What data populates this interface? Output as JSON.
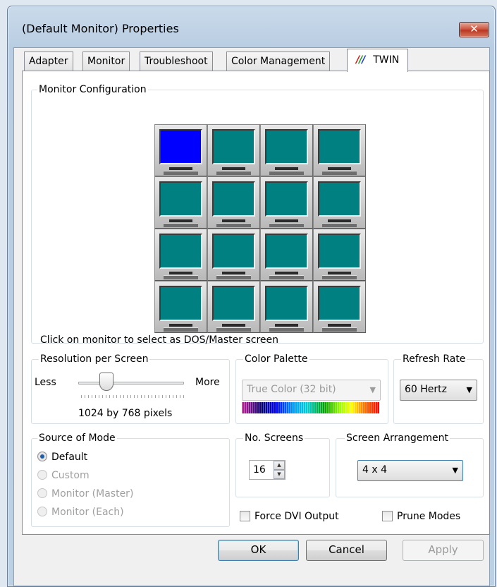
{
  "window": {
    "title": "(Default Monitor) Properties",
    "close_glyph": "✕"
  },
  "tabs": [
    {
      "label": "Adapter"
    },
    {
      "label": "Monitor"
    },
    {
      "label": "Troubleshoot"
    },
    {
      "label": "Color Management"
    },
    {
      "label": "TWIN",
      "logo": "///",
      "active": true
    }
  ],
  "monitor_config": {
    "label": "Monitor Configuration",
    "rows": 4,
    "cols": 4,
    "selected_index": 0,
    "hint": "Click on monitor to select as DOS/Master screen",
    "selected_color": "#0000ff",
    "default_color": "#008080"
  },
  "resolution": {
    "label": "Resolution per Screen",
    "less_label": "Less",
    "more_label": "More",
    "value_text": "1024 by 768 pixels"
  },
  "color_palette": {
    "label": "Color Palette",
    "selected": "True Color (32 bit)"
  },
  "refresh_rate": {
    "label": "Refresh Rate",
    "selected": "60 Hertz"
  },
  "source_of_mode": {
    "label": "Source of Mode",
    "options": [
      {
        "label": "Default",
        "checked": true,
        "enabled": true
      },
      {
        "label": "Custom",
        "checked": false,
        "enabled": false
      },
      {
        "label": "Monitor (Master)",
        "checked": false,
        "enabled": false
      },
      {
        "label": "Monitor (Each)",
        "checked": false,
        "enabled": false
      }
    ]
  },
  "no_screens": {
    "label": "No. Screens",
    "value": "16"
  },
  "screen_arrangement": {
    "label": "Screen Arrangement",
    "selected": "4 x 4"
  },
  "force_dvi": {
    "label": "Force DVI Output",
    "checked": false
  },
  "prune_modes": {
    "label": "Prune Modes",
    "checked": false
  },
  "buttons": {
    "ok": "OK",
    "cancel": "Cancel",
    "apply": "Apply"
  }
}
